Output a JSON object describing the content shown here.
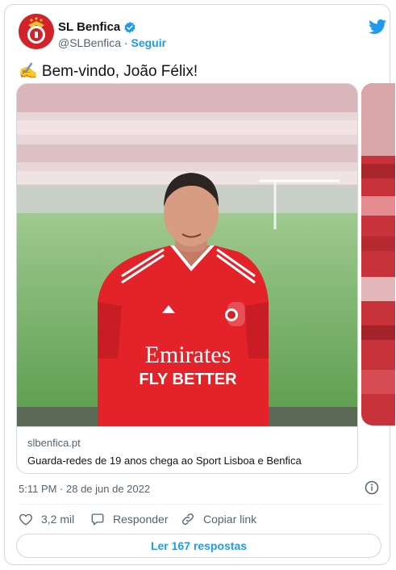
{
  "author": {
    "name": "SL Benfica",
    "handle": "@SLBenfica",
    "separator": "·",
    "follow_label": "Seguir"
  },
  "tweet": {
    "text": "✍️ Bem-vindo, João Félix!",
    "timestamp": "5:11 PM · 28 de jun de 2022"
  },
  "media": {
    "jersey_sponsor_line1": "Emirates",
    "jersey_sponsor_line2": "FLY BETTER",
    "link_domain": "slbenfica.pt",
    "link_title": "Guarda-redes de 19 anos chega ao Sport Lisboa e Benfica"
  },
  "actions": {
    "likes": "3,2 mil",
    "reply_label": "Responder",
    "copy_link_label": "Copiar link",
    "read_replies_label": "Ler 167 respostas"
  },
  "colors": {
    "accent": "#1d9bf0",
    "benfica_red": "#d2232a",
    "muted_text": "#536471",
    "border": "#cfd9de"
  },
  "icons": [
    "benfica-crest-icon",
    "verified-badge-icon",
    "twitter-bird-icon",
    "info-icon",
    "heart-icon",
    "reply-icon",
    "link-icon"
  ]
}
